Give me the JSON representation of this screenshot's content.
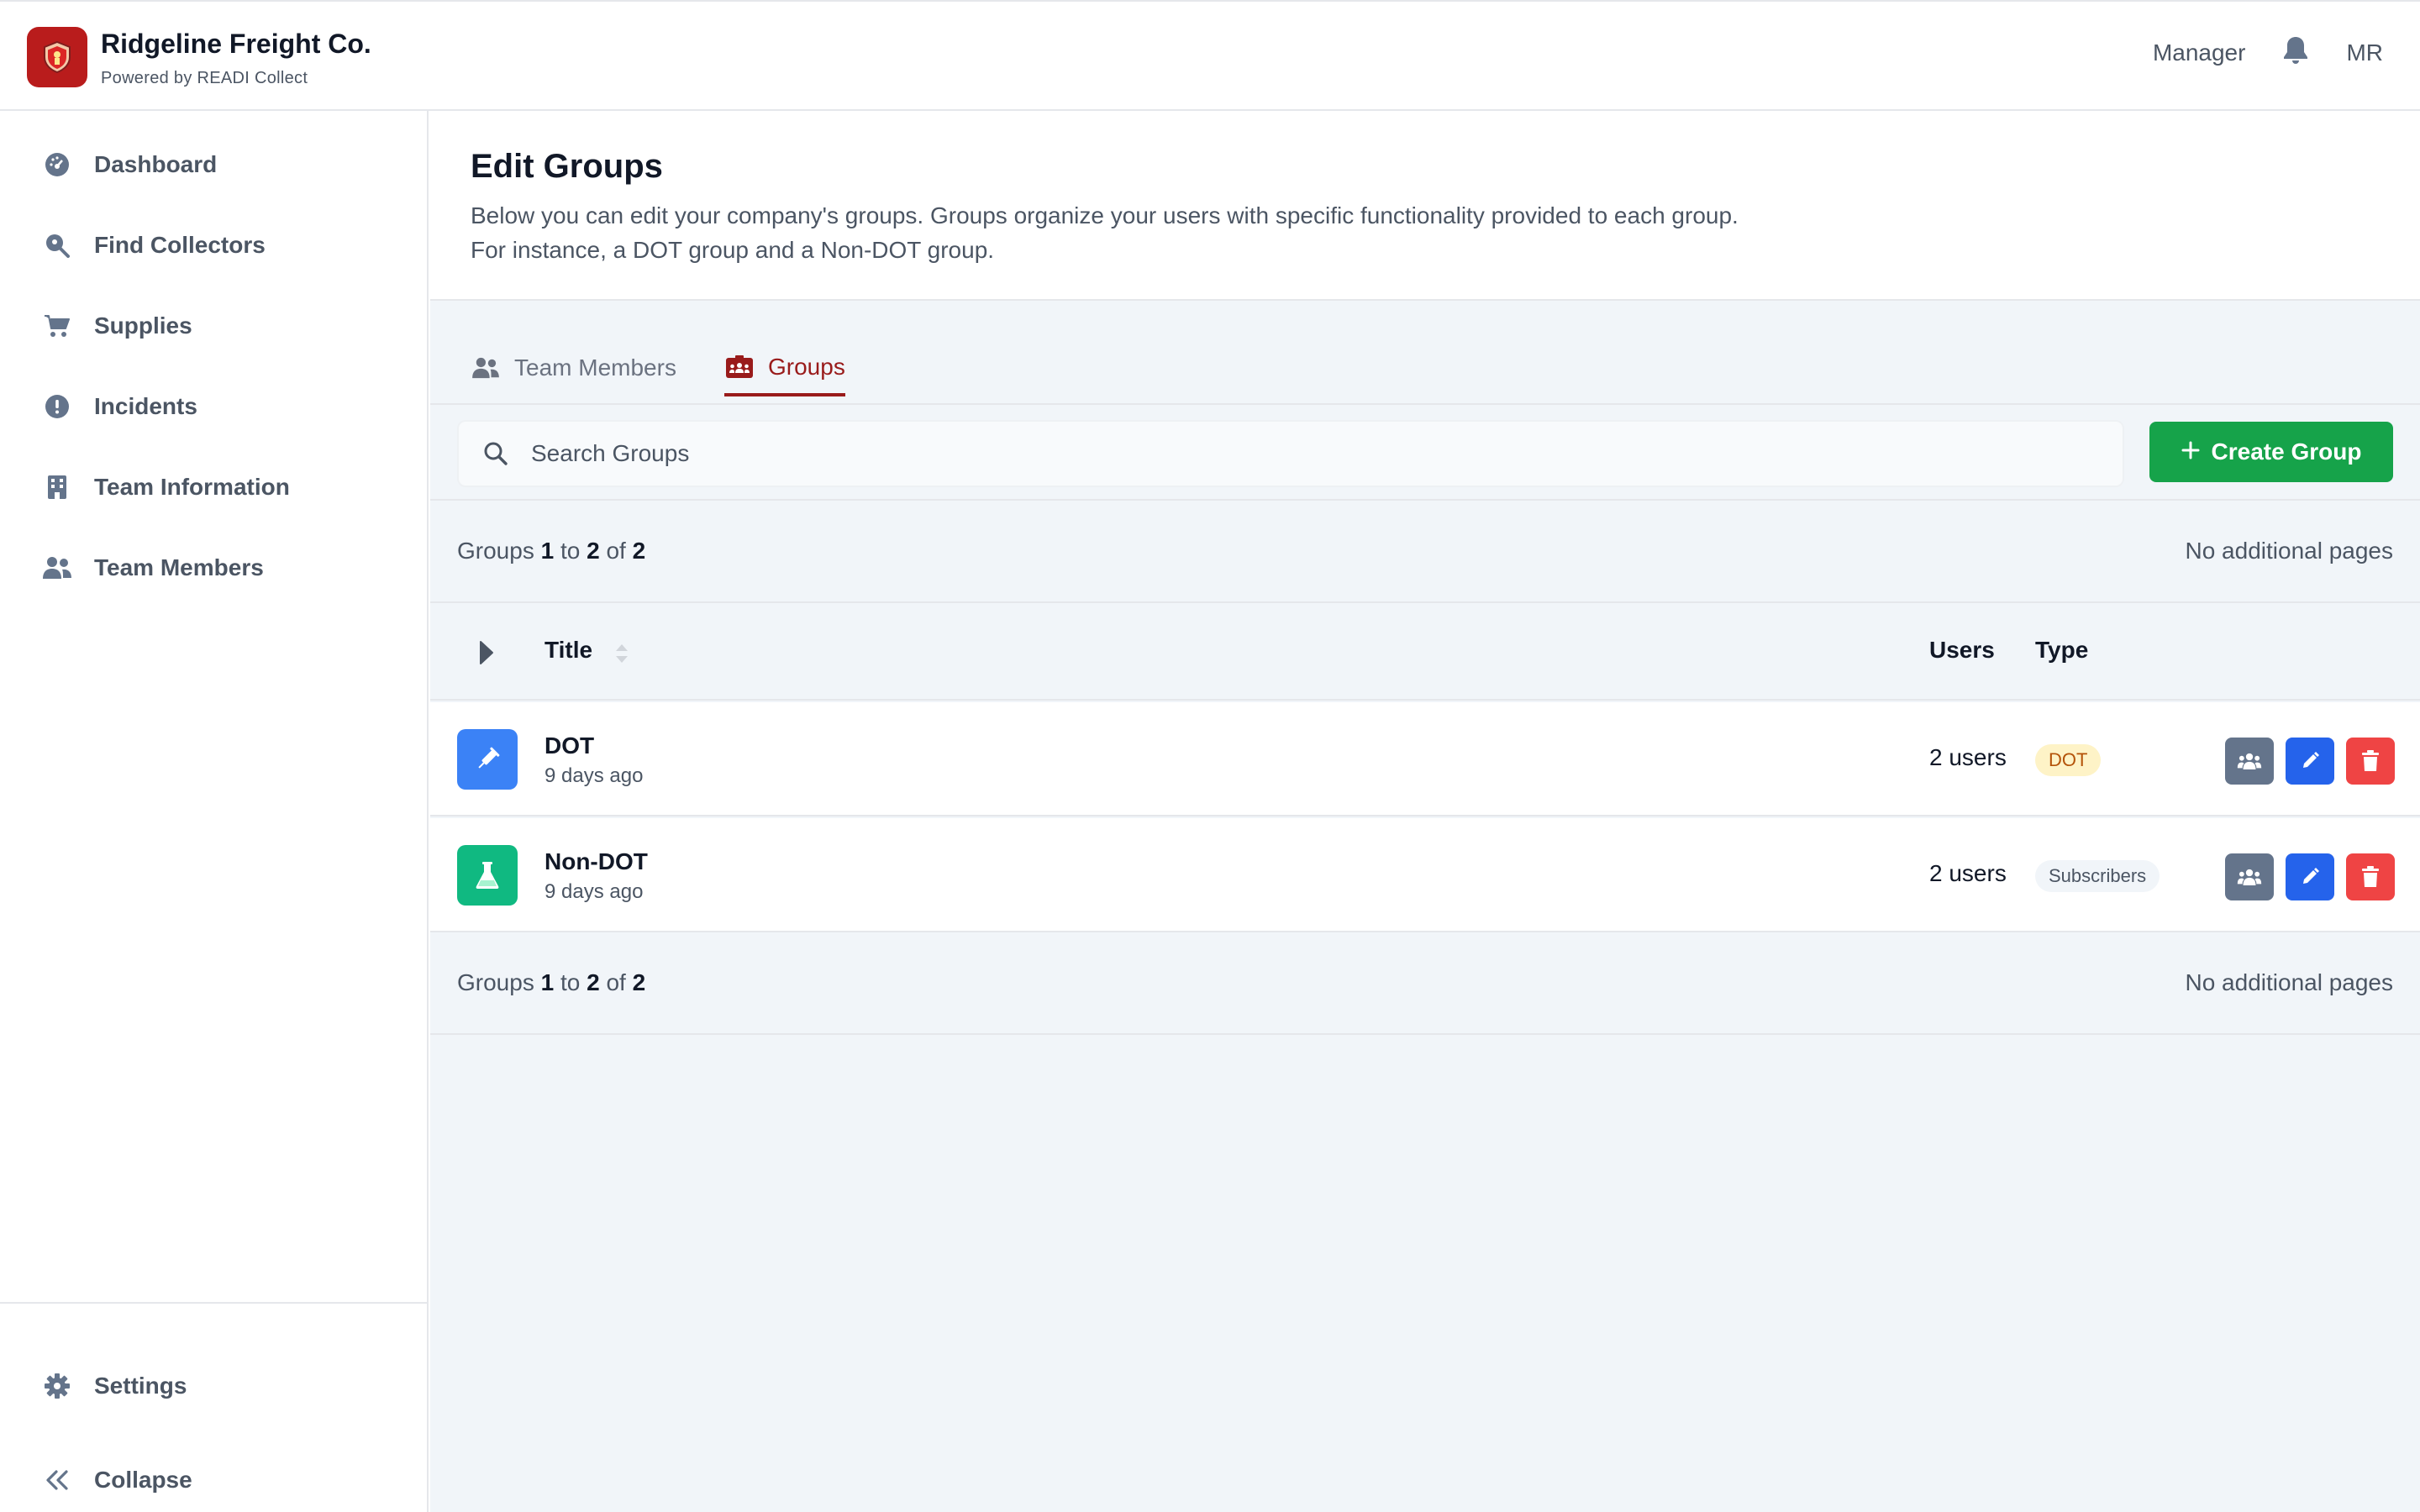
{
  "header": {
    "company": "Ridgeline Freight Co.",
    "powered_by": "Powered by READI Collect",
    "role": "Manager",
    "user_initials": "MR"
  },
  "sidebar": {
    "items": [
      {
        "label": "Dashboard",
        "icon": "dashboard-icon"
      },
      {
        "label": "Find Collectors",
        "icon": "search-location-icon"
      },
      {
        "label": "Supplies",
        "icon": "cart-icon"
      },
      {
        "label": "Incidents",
        "icon": "alert-circle-icon"
      },
      {
        "label": "Team Information",
        "icon": "building-icon"
      },
      {
        "label": "Team Members",
        "icon": "users-icon"
      }
    ],
    "settings_label": "Settings",
    "collapse_label": "Collapse"
  },
  "page": {
    "title": "Edit Groups",
    "description": "Below you can edit your company's groups. Groups organize your users with specific functionality provided to each group. For instance, a DOT group and a Non-DOT group."
  },
  "tabs": [
    {
      "label": "Team Members",
      "active": false
    },
    {
      "label": "Groups",
      "active": true
    }
  ],
  "search": {
    "placeholder": "Search Groups",
    "value": ""
  },
  "create_button": "Create Group",
  "pagination": {
    "prefix": "Groups",
    "start": "1",
    "to": "to",
    "end": "2",
    "of": "of",
    "total": "2",
    "pages_note": "No additional pages"
  },
  "table": {
    "columns": {
      "title": "Title",
      "users": "Users",
      "type": "Type"
    },
    "rows": [
      {
        "title": "DOT",
        "time": "9 days ago",
        "users": "2 users",
        "type": "DOT",
        "icon": "syringe-icon",
        "icon_color": "#3b82f6"
      },
      {
        "title": "Non-DOT",
        "time": "9 days ago",
        "users": "2 users",
        "type": "Subscribers",
        "icon": "flask-icon",
        "icon_color": "#10b981"
      }
    ]
  },
  "colors": {
    "brand": "#b91c1c",
    "accent_tab": "#991b1b",
    "create": "#16a34a",
    "action_members": "#64748b",
    "action_edit": "#2563eb",
    "action_delete": "#ef4444"
  }
}
